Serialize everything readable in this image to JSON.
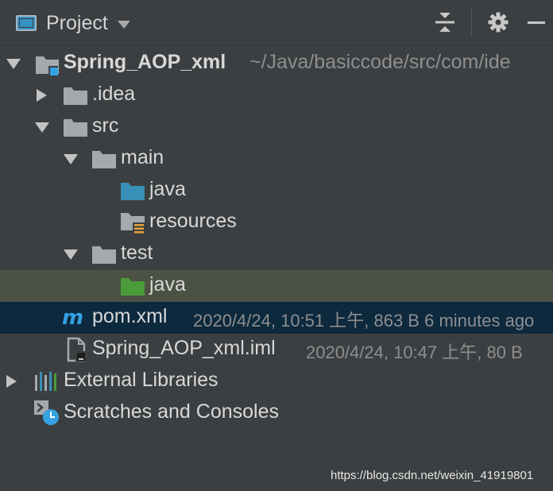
{
  "header": {
    "title": "Project"
  },
  "tree": {
    "root_name": "Spring_AOP_xml",
    "root_path": "~/Java/basiccode/src/com/ide",
    "idea": ".idea",
    "src": "src",
    "main": "main",
    "main_java": "java",
    "resources": "resources",
    "test": "test",
    "test_java": "java",
    "pom_name": "pom.xml",
    "pom_meta": "2020/4/24, 10:51 上午, 863 B 6 minutes ago",
    "iml_name": "Spring_AOP_xml.iml",
    "iml_meta": "2020/4/24, 10:47 上午, 80 B",
    "external_libraries": "External Libraries",
    "scratches": "Scratches and Consoles"
  },
  "watermark": "https://blog.csdn.net/weixin_41919801",
  "colors": {
    "background": "#3c3f41",
    "selection_test": "#4b5244",
    "selection_pom": "#0d293e",
    "folder_gray": "#a5a9ad",
    "folder_source": "#3a8fb7",
    "folder_test": "#4b9b3a",
    "maven_blue": "#35a1e2"
  },
  "icons": {
    "project": "project-icon",
    "collapse": "collapse-all-icon",
    "settings": "gear-icon",
    "minimize": "minimize-icon"
  }
}
